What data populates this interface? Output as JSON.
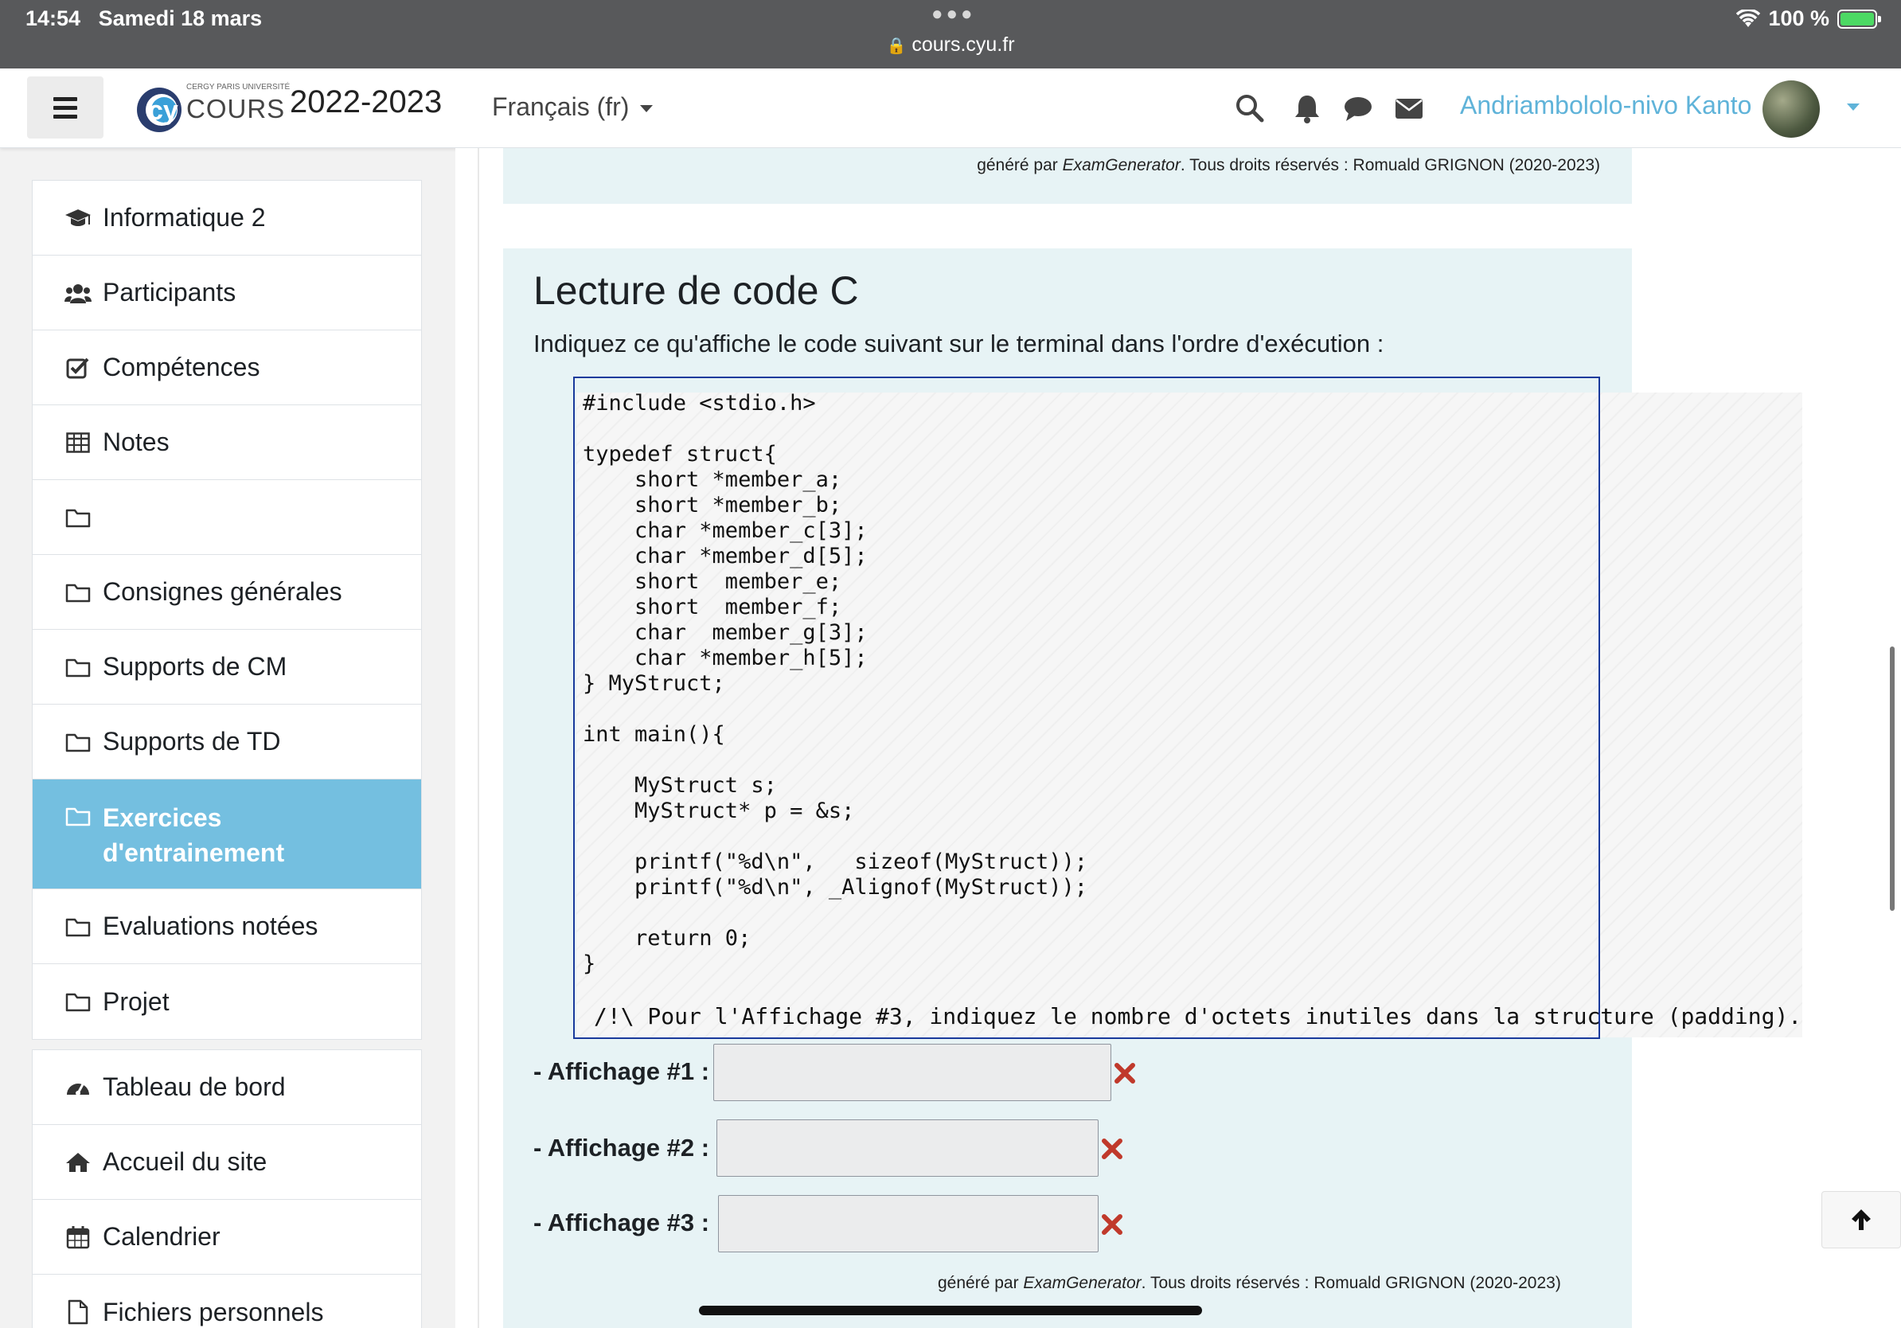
{
  "status_bar": {
    "time": "14:54",
    "date": "Samedi 18 mars",
    "url": "cours.cyu.fr",
    "battery": "100 %"
  },
  "navbar": {
    "logo_small": "CERGY PARIS UNIVERSITÉ",
    "logo_main": "COURS",
    "year": "2022-2023",
    "language": "Français (fr)",
    "username": "Andriambololo-nivo Kanto"
  },
  "sidebar": {
    "items": [
      {
        "label": "Informatique 2",
        "icon": "graduation-cap-icon"
      },
      {
        "label": "Participants",
        "icon": "users-icon"
      },
      {
        "label": "Compétences",
        "icon": "checkbox-icon"
      },
      {
        "label": "Notes",
        "icon": "table-icon"
      },
      {
        "label": "",
        "icon": "folder-icon"
      },
      {
        "label": "Consignes générales",
        "icon": "folder-icon"
      },
      {
        "label": "Supports de CM",
        "icon": "folder-icon"
      },
      {
        "label": "Supports de TD",
        "icon": "folder-icon"
      },
      {
        "label": "Exercices d'entrainement",
        "icon": "folder-icon",
        "active": true
      },
      {
        "label": "Evaluations notées",
        "icon": "folder-icon"
      },
      {
        "label": "Projet",
        "icon": "folder-icon"
      }
    ],
    "items2": [
      {
        "label": "Tableau de bord",
        "icon": "dashboard-icon"
      },
      {
        "label": "Accueil du site",
        "icon": "home-icon"
      },
      {
        "label": "Calendrier",
        "icon": "calendar-icon"
      },
      {
        "label": "Fichiers personnels",
        "icon": "file-icon"
      }
    ]
  },
  "main": {
    "footer_prefix": "généré par ",
    "footer_tool": "ExamGenerator",
    "footer_suffix": ". Tous droits réservés : Romuald GRIGNON (2020-2023)",
    "question_title": "Lecture de code C",
    "instruction": "Indiquez ce qu'affiche le code suivant sur le terminal dans l'ordre d'exécution :",
    "code": "#include <stdio.h>\n\ntypedef struct{\n    short *member_a;\n    short *member_b;\n    char *member_c[3];\n    char *member_d[5];\n    short  member_e;\n    short  member_f;\n    char  member_g[3];\n    char *member_h[5];\n} MyStruct;\n\nint main(){\n\n    MyStruct s;\n    MyStruct* p = &s;\n\n    printf(\"%d\\n\",   sizeof(MyStruct));\n    printf(\"%d\\n\", _Alignof(MyStruct));\n\n    return 0;\n}",
    "note": "/!\\ Pour l'Affichage #3, indiquez le nombre d'octets inutiles dans la structure (padding).",
    "answers": [
      {
        "label": "- Affichage #1 :",
        "value": ""
      },
      {
        "label": "- Affichage #2 :",
        "value": ""
      },
      {
        "label": "- Affichage #3 :",
        "value": ""
      }
    ]
  },
  "colors": {
    "accent": "#74bfe0",
    "username": "#5fb3d9",
    "card_bg": "#e7f3f5",
    "code_border": "#1a3a9c",
    "error": "#c0392b"
  }
}
